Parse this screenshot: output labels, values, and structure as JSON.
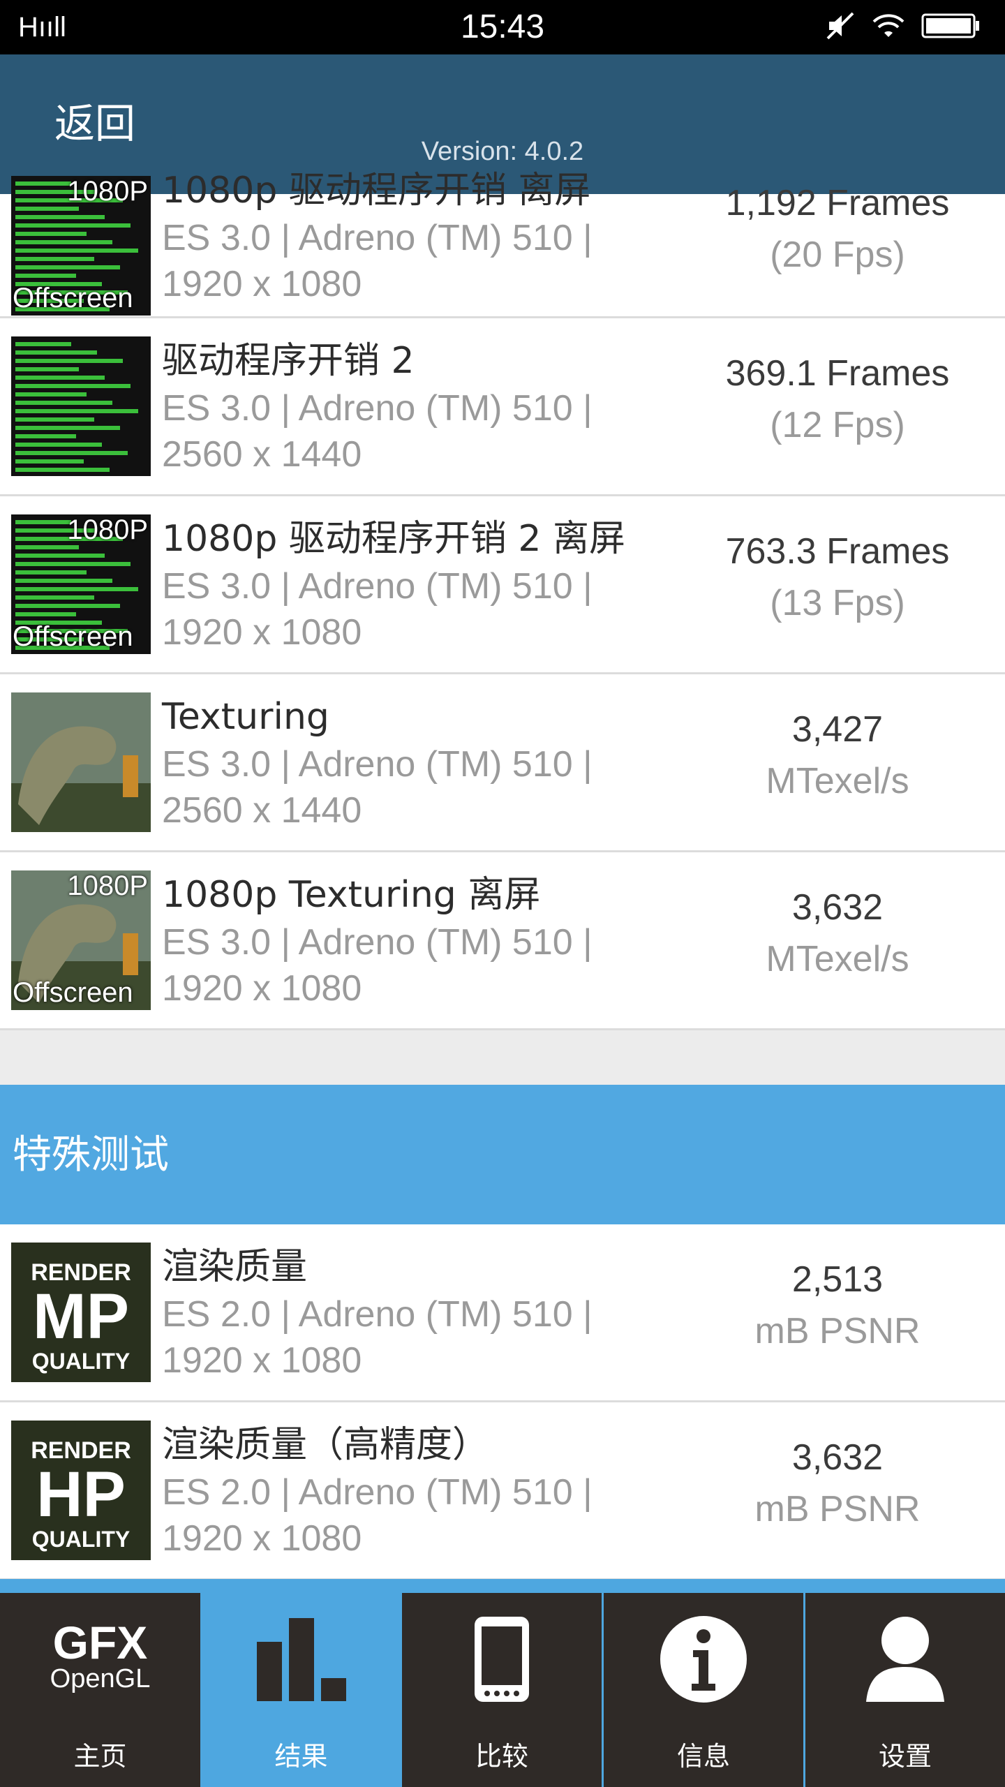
{
  "status_bar": {
    "signal": "Hııll",
    "time": "15:43"
  },
  "header": {
    "back_label": "返回",
    "version": "Version: 4.0.2"
  },
  "rows_top": [
    {
      "name": "1080p 驱动程序开销 离屏",
      "sub1": "ES 3.0 | Adreno (TM) 510 |",
      "sub2": "1920 x 1080",
      "score": "1,192 Frames",
      "unit": "(20 Fps)",
      "thumb": "driver-offscreen"
    },
    {
      "name": "驱动程序开销 2",
      "sub1": "ES 3.0 | Adreno (TM) 510 |",
      "sub2": "2560 x 1440",
      "score": "369.1 Frames",
      "unit": "(12 Fps)",
      "thumb": "driver"
    },
    {
      "name": "1080p 驱动程序开销 2 离屏",
      "sub1": "ES 3.0 | Adreno (TM) 510 |",
      "sub2": "1920 x 1080",
      "score": "763.3 Frames",
      "unit": "(13 Fps)",
      "thumb": "driver-offscreen"
    },
    {
      "name": "Texturing",
      "sub1": "ES 3.0 | Adreno (TM) 510 |",
      "sub2": "2560 x 1440",
      "score": "3,427",
      "unit": "MTexel/s",
      "thumb": "dino"
    },
    {
      "name": "1080p Texturing 离屏",
      "sub1": "ES 3.0 | Adreno (TM) 510 |",
      "sub2": "1920 x 1080",
      "score": "3,632",
      "unit": "MTexel/s",
      "thumb": "dino-offscreen"
    }
  ],
  "section": {
    "title": "特殊测试"
  },
  "rows_special": [
    {
      "name": "渲染质量",
      "sub1": "ES 2.0 | Adreno (TM) 510 |",
      "sub2": "1920 x 1080",
      "score": "2,513",
      "unit": "mB PSNR",
      "thumb": "render-mp"
    },
    {
      "name": "渲染质量（高精度）",
      "sub1": "ES 2.0 | Adreno (TM) 510 |",
      "sub2": "1920 x 1080",
      "score": "3,632",
      "unit": "mB PSNR",
      "thumb": "render-hp"
    }
  ],
  "thumb_text": {
    "p1080": "1080P",
    "offscreen": "Offscreen",
    "render": "RENDER",
    "mp": "MP",
    "hp": "HP",
    "quality": "QUALITY"
  },
  "bottom_nav": [
    {
      "label": "主页",
      "icon": "gfx-logo-icon",
      "logo_top": "GFX",
      "logo_bottom": "OpenGL",
      "active": false
    },
    {
      "label": "结果",
      "icon": "bar-chart-icon",
      "active": true
    },
    {
      "label": "比较",
      "icon": "phone-icon",
      "active": false
    },
    {
      "label": "信息",
      "icon": "info-icon",
      "active": false
    },
    {
      "label": "设置",
      "icon": "user-icon",
      "active": false
    }
  ],
  "colors": {
    "header": "#2b5876",
    "section": "#51a8e1",
    "nav_bg": "#2f2a27",
    "nav_active": "#4ea7e0"
  }
}
